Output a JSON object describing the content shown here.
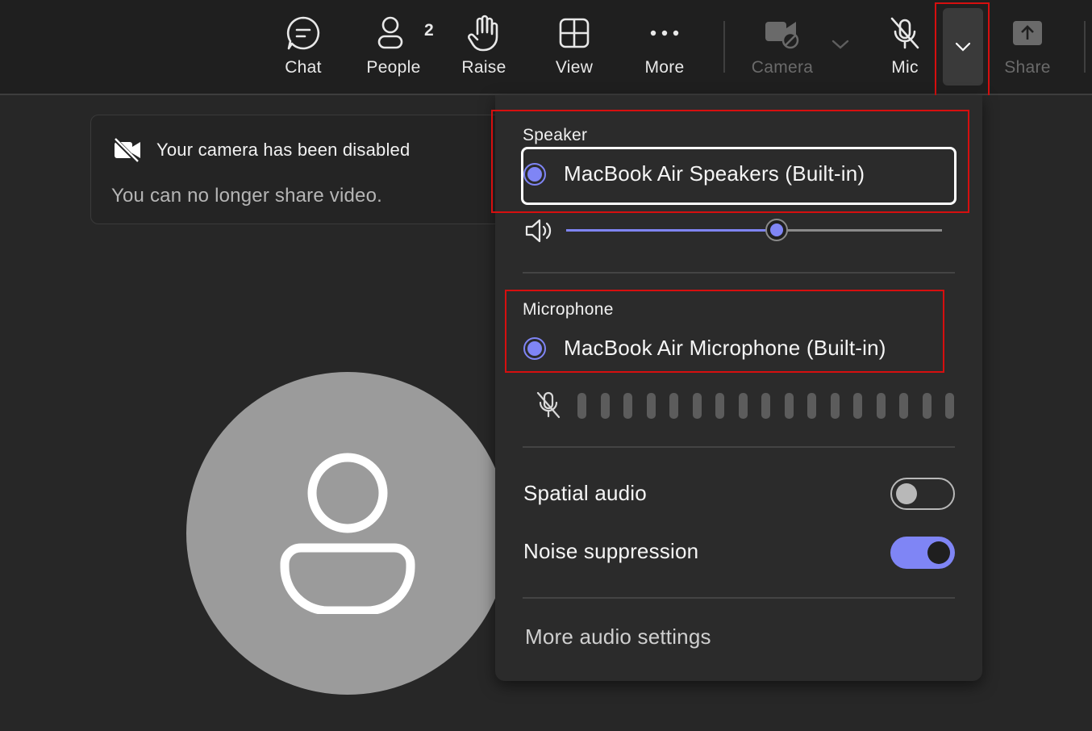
{
  "toolbar": {
    "chat_label": "Chat",
    "people_label": "People",
    "people_count": "2",
    "raise_label": "Raise",
    "view_label": "View",
    "more_label": "More",
    "camera_label": "Camera",
    "mic_label": "Mic",
    "share_label": "Share",
    "icons": [
      "chat-icon",
      "people-icon",
      "raise-hand-icon",
      "view-grid-icon",
      "more-dots-icon",
      "camera-off-icon",
      "chevron-down-icon",
      "mic-off-icon",
      "chevron-down-icon",
      "share-icon"
    ]
  },
  "notice": {
    "title": "Your camera has been disabled",
    "subtitle": "You can no longer share video.",
    "icon": "video-off-icon"
  },
  "audio_panel": {
    "speaker_label": "Speaker",
    "speaker_device": "MacBook Air Speakers (Built-in)",
    "speaker_volume_fraction": 0.56,
    "microphone_label": "Microphone",
    "microphone_device": "MacBook Air Microphone (Built-in)",
    "mic_meter_level_fraction": 0,
    "spatial_audio_label": "Spatial audio",
    "spatial_audio_on": false,
    "noise_suppression_label": "Noise suppression",
    "noise_suppression_on": true,
    "more_settings_label": "More audio settings"
  },
  "colors": {
    "accent": "#7f85f5",
    "highlight": "#d60f0f",
    "background": "#1f1f1f",
    "panel": "#2b2b2b",
    "avatar": "#9b9b9b"
  }
}
